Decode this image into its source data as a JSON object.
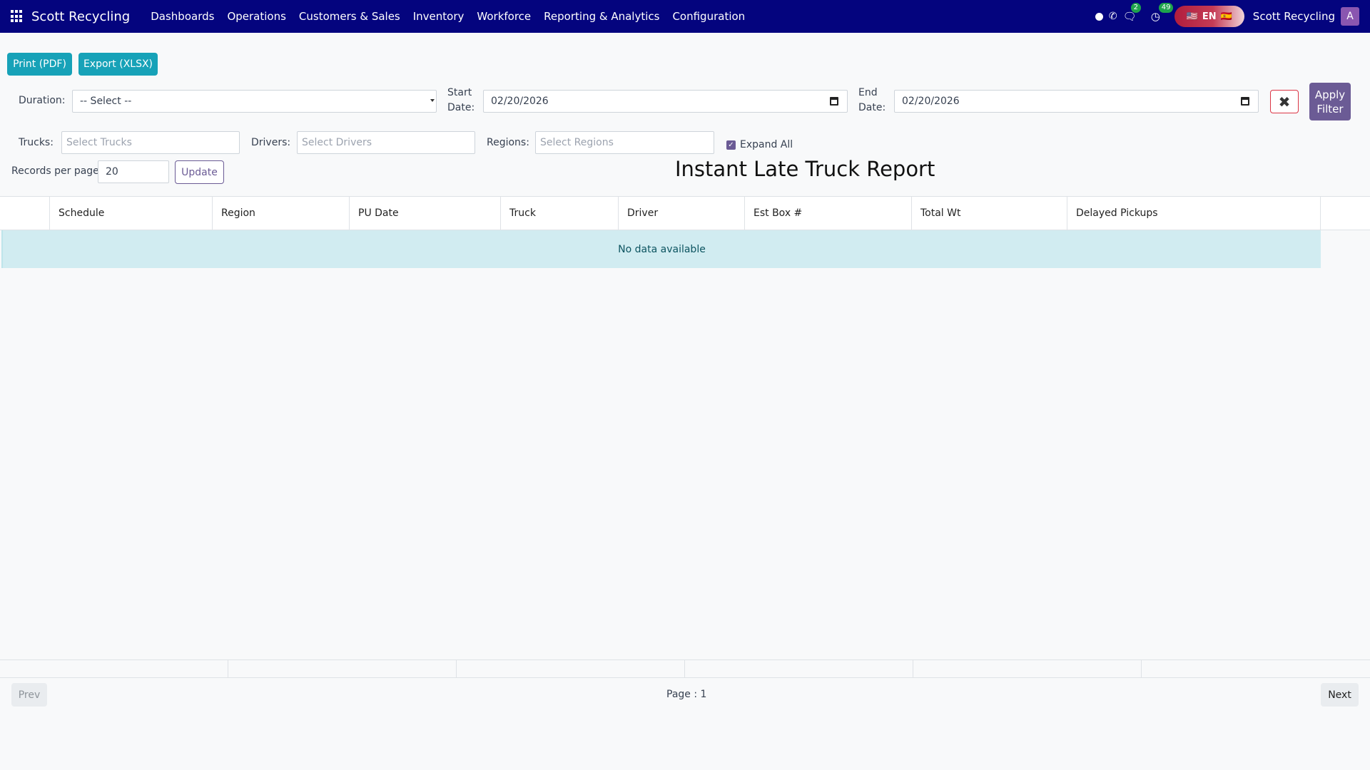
{
  "navbar": {
    "brand": "Scott Recycling",
    "menu": [
      "Dashboards",
      "Operations",
      "Customers & Sales",
      "Inventory",
      "Workforce",
      "Reporting & Analytics",
      "Configuration"
    ],
    "messages_badge": "2",
    "activities_badge": "49",
    "lang_code": "EN",
    "flag_left": "🇺🇸",
    "flag_right": "🇪🇸",
    "company": "Scott Recycling",
    "avatar_letter": "A",
    "bg_color": "#04047e"
  },
  "actions": {
    "print_label": "Print (PDF)",
    "export_label": "Export (XLSX)"
  },
  "filters": {
    "duration_label": "Duration:",
    "duration_value": "-- Select --",
    "start_label_1": "Start",
    "start_label_2": "Date:",
    "start_value": "02/20/2026",
    "end_label_1": "End",
    "end_label_2": "Date:",
    "end_value": "02/20/2026",
    "apply_label_1": "Apply",
    "apply_label_2": "Filter",
    "trucks_label": "Trucks:",
    "trucks_placeholder": "Select Trucks",
    "drivers_label": "Drivers:",
    "drivers_placeholder": "Select Drivers",
    "regions_label": "Regions:",
    "regions_placeholder": "Select Regions",
    "expand_all_label": "Expand All",
    "expand_all_checked": true,
    "rpp_label": "Records per page:",
    "rpp_value": "20",
    "update_label": "Update"
  },
  "report": {
    "title": "Instant Late Truck Report",
    "columns": [
      "Schedule",
      "Region",
      "PU Date",
      "Truck",
      "Driver",
      "Est Box #",
      "Total Wt",
      "Delayed Pickups"
    ],
    "empty_message": "No data available"
  },
  "pagination": {
    "prev_label": "Prev",
    "page_label": "Page : 1",
    "next_label": "Next"
  }
}
